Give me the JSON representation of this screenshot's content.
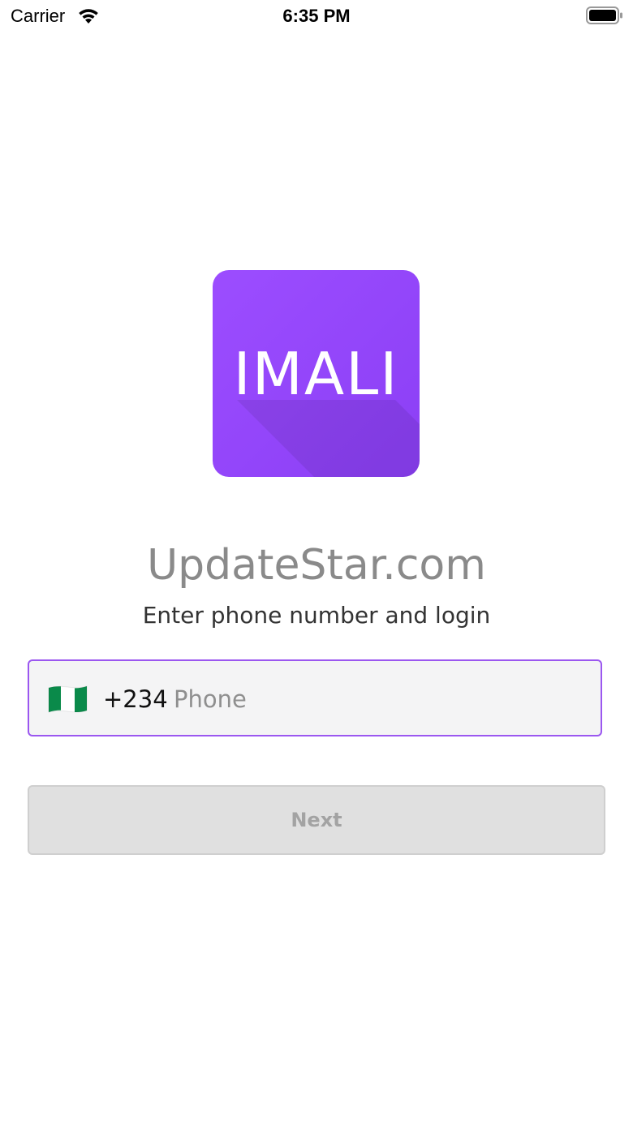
{
  "status_bar": {
    "carrier": "Carrier",
    "time": "6:35 PM",
    "wifi_icon": "wifi-icon",
    "battery_icon": "battery-icon"
  },
  "logo": {
    "text": "IMALI",
    "color": "#9747ff"
  },
  "brand": {
    "title": "UpdateStar.com",
    "subtitle": "Enter phone number and login"
  },
  "phone_field": {
    "country_flag_icon": "nigeria-flag-icon",
    "dial_code": "+234",
    "value": "",
    "placeholder": "Phone",
    "focus_border_color": "#9b57f0"
  },
  "next_button": {
    "label": "Next",
    "enabled": false
  }
}
